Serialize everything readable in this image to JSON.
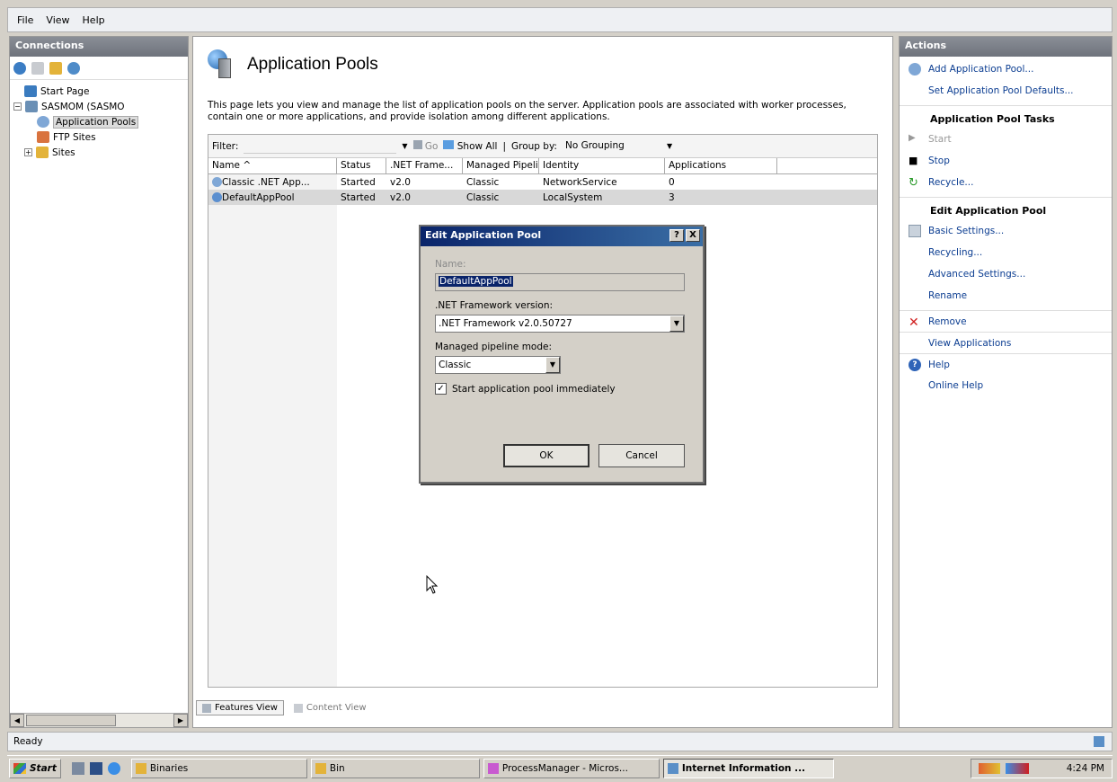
{
  "menubar": {
    "items": [
      "File",
      "View",
      "Help"
    ]
  },
  "connections": {
    "title": "Connections",
    "tree": {
      "start_page": "Start Page",
      "server": "SASMOM (SASMO",
      "app_pools": "Application Pools",
      "ftp_sites": "FTP Sites",
      "sites": "Sites"
    }
  },
  "main": {
    "title": "Application Pools",
    "description": "This page lets you view and manage the list of application pools on the server. Application pools are associated with worker processes, contain one or more applications, and provide isolation among different applications.",
    "filter_label": "Filter:",
    "go_label": "Go",
    "show_all_label": "Show All",
    "group_by_label": "Group by:",
    "group_by_value": "No Grouping",
    "columns": [
      "Name",
      ".NET Frame...",
      "Status",
      "Managed Pipeli...",
      "Identity",
      "Applications"
    ],
    "column_order": {
      "name": "Name",
      "status": "Status",
      "net": ".NET Frame...",
      "pipe": "Managed Pipeli...",
      "identity": "Identity",
      "apps": "Applications"
    },
    "rows": [
      {
        "name": "Classic .NET App...",
        "status": "Started",
        "net": "v2.0",
        "pipe": "Classic",
        "identity": "NetworkService",
        "apps": "0"
      },
      {
        "name": "DefaultAppPool",
        "status": "Started",
        "net": "v2.0",
        "pipe": "Classic",
        "identity": "LocalSystem",
        "apps": "3"
      }
    ],
    "view_tabs": {
      "features": "Features View",
      "content": "Content View"
    }
  },
  "actions": {
    "title": "Actions",
    "add_pool": "Add Application Pool...",
    "set_defaults": "Set Application Pool Defaults...",
    "tasks_header": "Application Pool Tasks",
    "start": "Start",
    "stop": "Stop",
    "recycle": "Recycle...",
    "edit_header": "Edit Application Pool",
    "basic_settings": "Basic Settings...",
    "recycling": "Recycling...",
    "advanced_settings": "Advanced Settings...",
    "rename": "Rename",
    "remove": "Remove",
    "view_apps": "View Applications",
    "help": "Help",
    "online_help": "Online Help"
  },
  "dialog": {
    "title": "Edit Application Pool",
    "help_btn": "?",
    "close_btn": "X",
    "name_label": "Name:",
    "name_value": "DefaultAppPool",
    "net_label": ".NET Framework version:",
    "net_value": ".NET Framework v2.0.50727",
    "pipeline_label": "Managed pipeline mode:",
    "pipeline_value": "Classic",
    "start_immediately": "Start application pool immediately",
    "ok": "OK",
    "cancel": "Cancel"
  },
  "statusbar": {
    "text": "Ready"
  },
  "taskbar": {
    "start": "Start",
    "binaries": "Binaries",
    "bin": "Bin",
    "process_manager": "ProcessManager - Micros...",
    "iis": "Internet Information ...",
    "clock": "4:24 PM"
  },
  "colors": {
    "accent": "#0a246a",
    "panel_head": "#6e737c",
    "link": "#0b3d91"
  }
}
